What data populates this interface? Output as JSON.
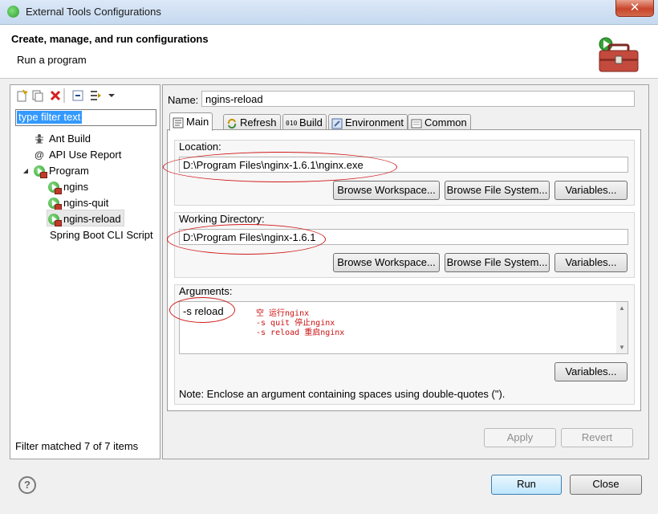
{
  "window": {
    "title": "External Tools Configurations",
    "close_symbol": "✕"
  },
  "header": {
    "title": "Create, manage, and run configurations",
    "subtitle": "Run a program"
  },
  "left": {
    "filter_placeholder": "type filter text",
    "tree": [
      {
        "label": "Ant Build",
        "icon": "ant-icon"
      },
      {
        "label": "API Use Report",
        "icon": "api-report-icon"
      },
      {
        "label": "Program",
        "icon": "program-icon",
        "expanded": true
      },
      {
        "label": "ngins",
        "icon": "program-launch-icon"
      },
      {
        "label": "ngins-quit",
        "icon": "program-launch-icon"
      },
      {
        "label": "ngins-reload",
        "icon": "program-launch-icon",
        "selected": true
      },
      {
        "label": "Spring Boot CLI Script",
        "icon": ""
      }
    ],
    "status": "Filter matched 7 of 7 items"
  },
  "right": {
    "name_label": "Name:",
    "name_value": "ngins-reload",
    "tabs": [
      {
        "label": "Main",
        "active": true
      },
      {
        "label": "Refresh"
      },
      {
        "label": "Build"
      },
      {
        "label": "Environment"
      },
      {
        "label": "Common"
      }
    ],
    "location": {
      "label": "Location:",
      "value": "D:\\Program Files\\nginx-1.6.1\\nginx.exe"
    },
    "working_dir": {
      "label": "Working Directory:",
      "value": "D:\\Program Files\\nginx-1.6.1"
    },
    "buttons": {
      "browse_workspace": "Browse Workspace...",
      "browse_fs": "Browse File System...",
      "variables": "Variables..."
    },
    "arguments": {
      "label": "Arguments:",
      "value": "-s reload",
      "annotations": [
        "空 运行nginx",
        "-s quit 停止nginx",
        "-s reload 重启nginx"
      ]
    },
    "note": "Note: Enclose an argument containing spaces using double-quotes (\").",
    "apply": "Apply",
    "revert": "Revert"
  },
  "footer": {
    "help": "?",
    "run": "Run",
    "close": "Close"
  },
  "colors": {
    "annotation_red": "#d01a1a",
    "selection_blue": "#3399ff"
  }
}
